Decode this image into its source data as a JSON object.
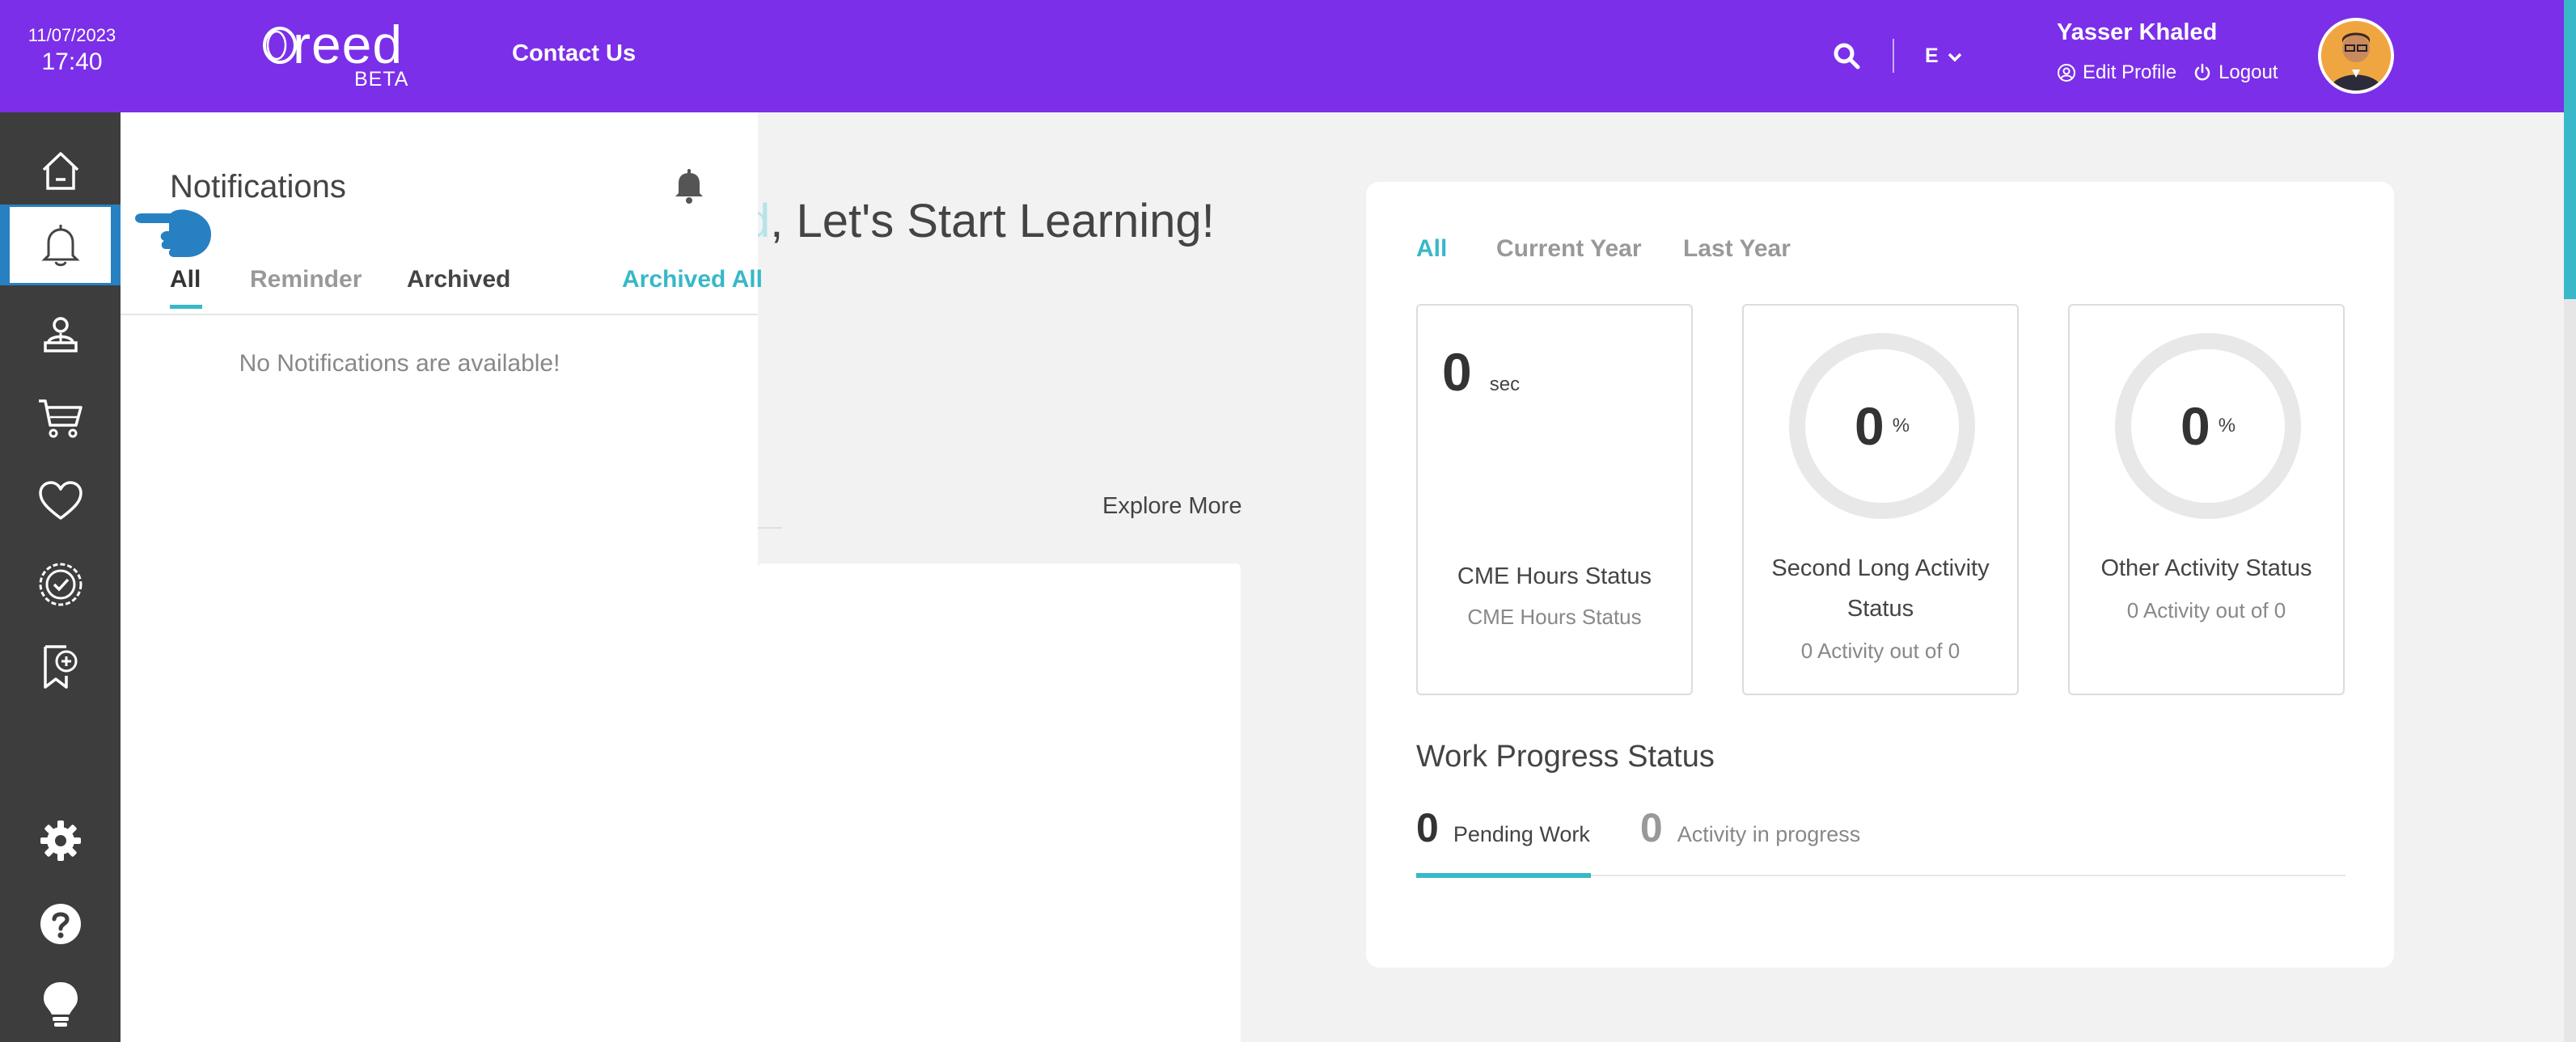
{
  "header": {
    "date": "11/07/2023",
    "time": "17:40",
    "logo_text": "reed",
    "logo_beta": "BETA",
    "contact_label": "Contact Us",
    "language": "E",
    "user_name": "Yasser Khaled",
    "edit_profile_label": "Edit Profile",
    "logout_label": "Logout"
  },
  "sidebar": {
    "items": [
      {
        "icon": "home-icon"
      },
      {
        "icon": "bell-icon",
        "active": true
      },
      {
        "icon": "instructor-icon"
      },
      {
        "icon": "cart-icon"
      },
      {
        "icon": "heart-icon"
      },
      {
        "icon": "certificate-icon"
      },
      {
        "icon": "bookmark-plus-icon"
      },
      {
        "icon": "gear-icon"
      },
      {
        "icon": "help-icon"
      },
      {
        "icon": "lightbulb-icon"
      }
    ]
  },
  "notifications": {
    "title": "Notifications",
    "tabs": [
      "All",
      "Reminder",
      "Archived"
    ],
    "archive_all_label": "Archived All",
    "empty_message": "No Notifications are available!"
  },
  "main": {
    "welcome_highlight": "d",
    "welcome_text": ", Let's Start Learning!",
    "explore_more": "Explore More"
  },
  "stats": {
    "tabs": [
      "All",
      "Current Year",
      "Last Year"
    ],
    "cards": [
      {
        "value": "0",
        "unit": "sec",
        "title": "CME Hours Status",
        "subtitle": "CME Hours Status"
      },
      {
        "value": "0",
        "unit": "%",
        "title_line1": "Second Long Activity",
        "title_line2": "Status",
        "subtitle": "0 Activity out of 0"
      },
      {
        "value": "0",
        "unit": "%",
        "title": "Other Activity Status",
        "subtitle": "0 Activity out of 0"
      }
    ],
    "work_progress": {
      "title": "Work Progress Status",
      "pending_value": "0",
      "pending_label": "Pending Work",
      "in_progress_value": "0",
      "in_progress_label": "Activity in progress"
    }
  },
  "colors": {
    "header_purple": "#7b2fe8",
    "accent_teal": "#38b8c8",
    "sidebar_dark": "#3d3d3d",
    "active_blue": "#2680c2"
  }
}
